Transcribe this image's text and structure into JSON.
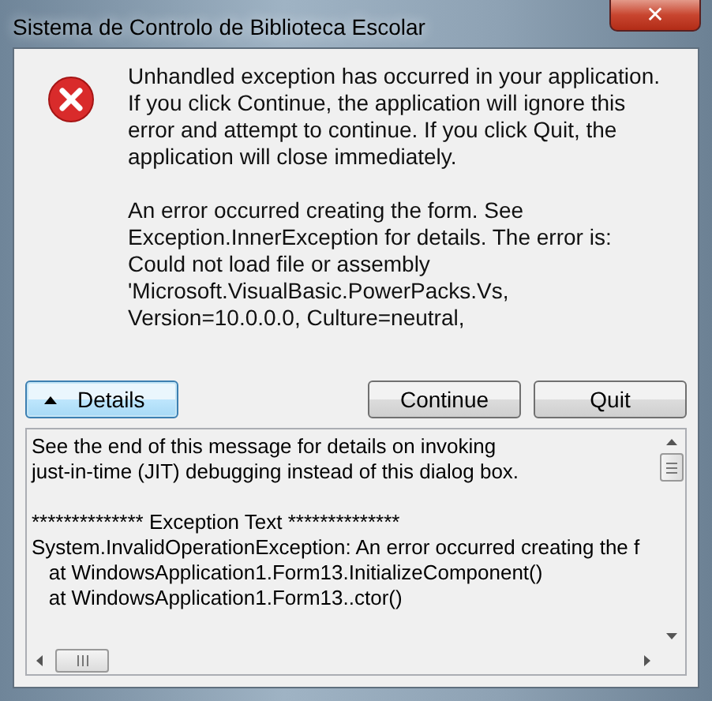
{
  "window": {
    "title": "Sistema de Controlo de Biblioteca Escolar",
    "close": "✕"
  },
  "message": [
    [
      "Unhandled exception has occurred in your application.",
      "If you click Continue, the application will ignore this",
      "error and attempt to continue. If you click Quit, the",
      "application will close immediately."
    ],
    [
      "An error occurred creating the form. See",
      "Exception.InnerException for details.  The error is:",
      "Could not load file or assembly",
      "'Microsoft.VisualBasic.PowerPacks.Vs,",
      "Version=10.0.0.0, Culture=neutral,"
    ]
  ],
  "buttons": [
    {
      "label": "Details",
      "kind": "toggle",
      "expanded": true
    },
    {
      "label": "Continue",
      "kind": "plain"
    },
    {
      "label": "Quit",
      "kind": "plain"
    }
  ],
  "details": [
    [
      "See the end of this message for details on invoking",
      "just-in-time (JIT) debugging instead of this dialog box."
    ],
    [
      "************** Exception Text **************",
      "System.InvalidOperationException: An error occurred creating the f",
      "   at WindowsApplication1.Form13.InitializeComponent()",
      "   at WindowsApplication1.Form13..ctor()"
    ]
  ]
}
